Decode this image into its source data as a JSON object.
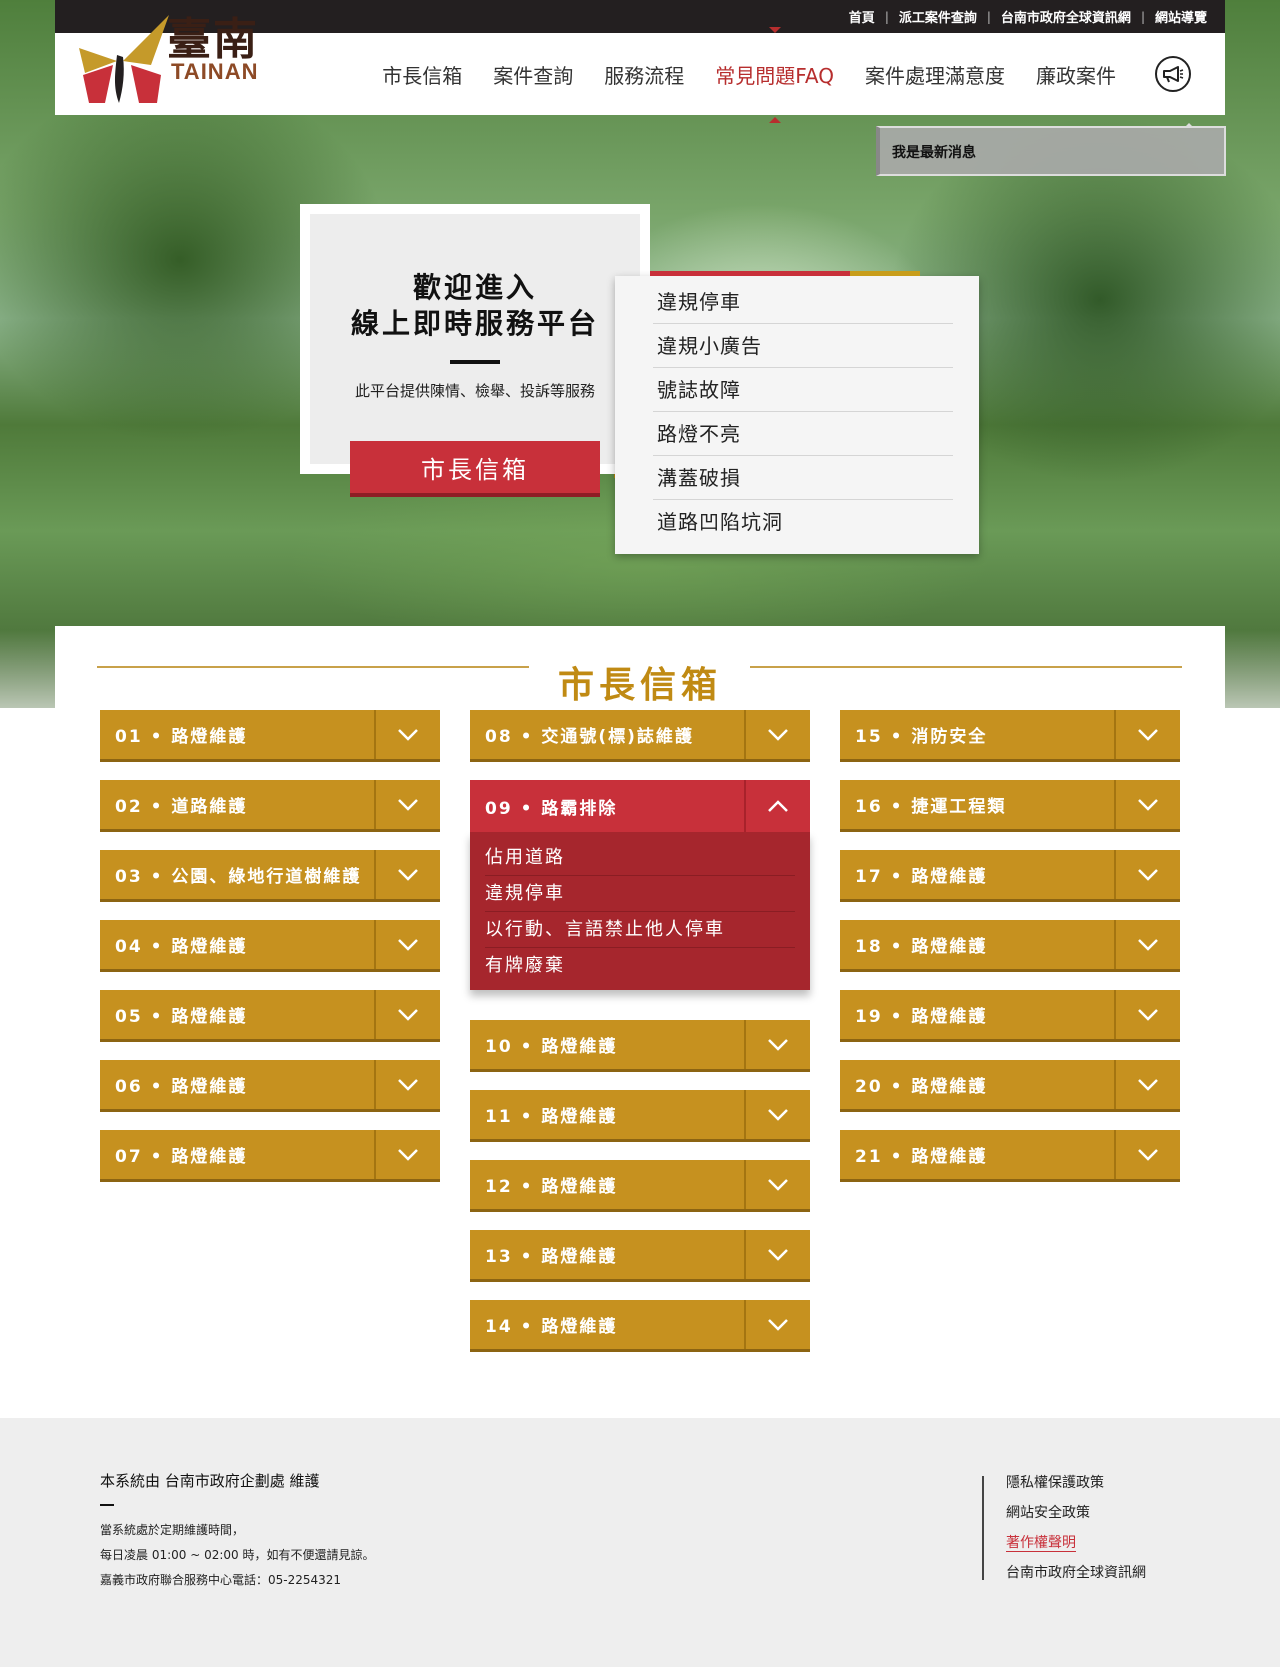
{
  "topbar": {
    "links": [
      "首頁",
      "派工案件查詢",
      "台南市政府全球資訊網",
      "網站導覽"
    ]
  },
  "logo": {
    "han": "臺南",
    "latin": "TAINAN"
  },
  "nav": {
    "items": [
      "市長信箱",
      "案件查詢",
      "服務流程",
      "常見問題FAQ",
      "案件處理滿意度",
      "廉政案件"
    ],
    "active": "常見問題FAQ",
    "announce_icon": "megaphone-icon"
  },
  "news": {
    "text": "我是最新消息"
  },
  "hero": {
    "title_line1": "歡迎進入",
    "title_line2": "線上即時服務平台",
    "subtitle": "此平台提供陳情、檢舉、投訴等服務",
    "button": "市長信箱"
  },
  "quick_links": [
    "違規停車",
    "違規小廣告",
    "號誌故障",
    "路燈不亮",
    "溝蓋破損",
    "道路凹陷坑洞"
  ],
  "section": {
    "title": "市長信箱"
  },
  "categories": {
    "col1": [
      "01 • 路燈維護",
      "02 • 道路維護",
      "03 • 公園、綠地行道樹維護",
      "04 • 路燈維護",
      "05 • 路燈維護",
      "06 • 路燈維護",
      "07 • 路燈維護"
    ],
    "col2_before": [
      "08 • 交通號(標)誌維護"
    ],
    "col2_open": {
      "label": "09 • 路霸排除",
      "items": [
        "佔用道路",
        "違規停車",
        "以行動、言語禁止他人停車",
        "有牌廢棄"
      ]
    },
    "col2_after": [
      "10 • 路燈維護",
      "11 • 路燈維護",
      "12 • 路燈維護",
      "13 • 路燈維護",
      "14 • 路燈維護"
    ],
    "col3": [
      "15 • 消防安全",
      "16 • 捷運工程類",
      "17 • 路燈維護",
      "18 • 路燈維護",
      "19 • 路燈維護",
      "20 • 路燈維護",
      "21 • 路燈維護"
    ]
  },
  "footer": {
    "org": "本系統由 台南市政府企劃處 維護",
    "notes": [
      "當系統處於定期維護時間，",
      "每日凌晨 01:00 ~ 02:00 時，如有不便還請見諒。",
      "嘉義市政府聯合服務中心電話：05-2254321"
    ],
    "links": [
      "隱私權保護政策",
      "網站安全政策",
      "著作權聲明",
      "台南市政府全球資訊網"
    ],
    "highlight_link": "著作權聲明"
  },
  "colors": {
    "gold": "#c6911f",
    "red": "#c8303a",
    "dark_red": "#a6262d",
    "topbar": "#231f20"
  }
}
